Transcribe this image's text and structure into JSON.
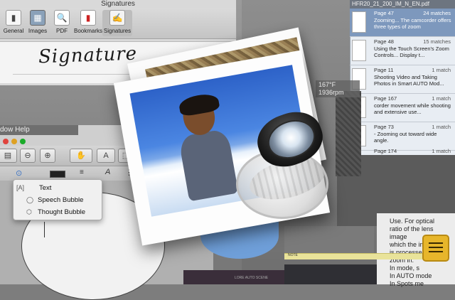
{
  "prefs": {
    "title": "Signatures",
    "toolbar": [
      {
        "label": "General",
        "icon": "switch-icon"
      },
      {
        "label": "Images",
        "icon": "images-icon"
      },
      {
        "label": "PDF",
        "icon": "pdf-icon"
      },
      {
        "label": "Bookmarks",
        "icon": "bookmarks-icon"
      },
      {
        "label": "Signatures",
        "icon": "signature-icon"
      }
    ],
    "signature_text": "Signature"
  },
  "docwin": {
    "menu_fragment": "dow   Help"
  },
  "markup_menu": {
    "items": [
      {
        "label": "Text",
        "icon": "text-box-icon"
      },
      {
        "label": "Speech Bubble",
        "icon": "speech-bubble-icon"
      },
      {
        "label": "Thought Bubble",
        "icon": "thought-bubble-icon"
      }
    ]
  },
  "results": {
    "title": "HFR20_21_200_IM_N_EN.pdf",
    "items": [
      {
        "page": "Page 47",
        "matches": "24 matches",
        "snippet": "Zooming... The camcorder offers three types of zoom"
      },
      {
        "page": "Page 48",
        "matches": "15 matches",
        "snippet": "Using the Touch Screen's Zoom Controls... Display t..."
      },
      {
        "page": "Page 11",
        "matches": "1 match",
        "snippet": "Shooting Video and Taking Photos in Smart AUTO Mod..."
      },
      {
        "page": "Page 167",
        "matches": "1 match",
        "snippet": "corder movement while shooting and extensive use..."
      },
      {
        "page": "Page 73",
        "matches": "1 match",
        "snippet": "- Zooming out toward wide angle."
      },
      {
        "page": "Page 174",
        "matches": "1 match",
        "snippet": ""
      }
    ]
  },
  "inspector": {
    "line1": "167°F",
    "line2": "1936rpm"
  },
  "doc_right": {
    "lines": [
      "Use. For optical",
      "ratio of the lens",
      "image",
      "which the image",
      "is processed",
      "zoom in.",
      "In      mode, s",
      "In AUTO mode",
      "In       Spots me"
    ]
  },
  "note_label": "NOTE",
  "dark_label": "LORE AUTO SCENE"
}
